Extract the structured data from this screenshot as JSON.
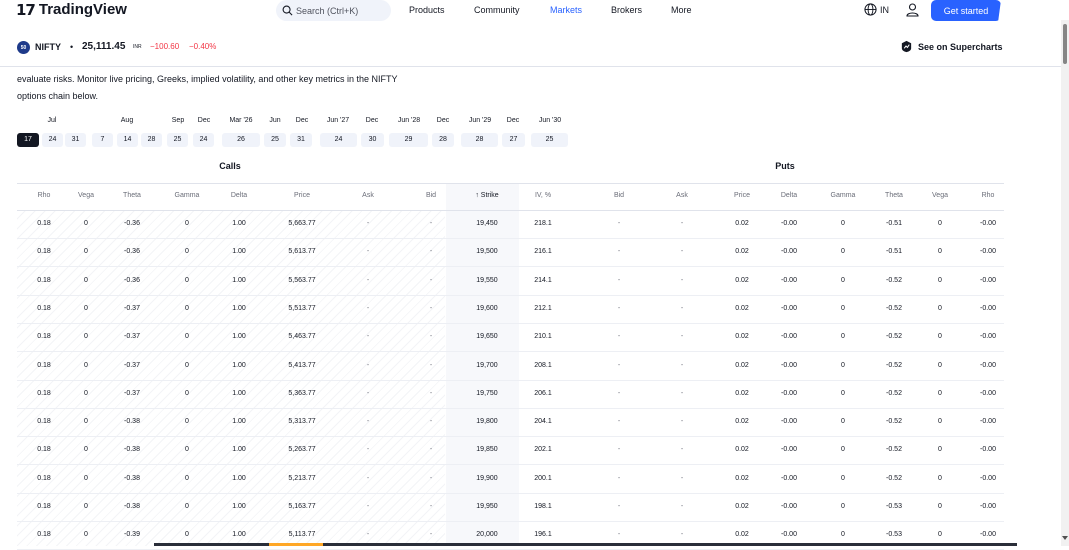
{
  "header": {
    "brand": "TradingView",
    "logo_mark": "17",
    "search_placeholder": "Search (Ctrl+K)",
    "nav": [
      "Products",
      "Community",
      "Markets",
      "Brokers",
      "More"
    ],
    "active_nav": "Markets",
    "region": "IN",
    "cta": "Get started",
    "accent_color": "#2962ff"
  },
  "symbol": {
    "badge": "50",
    "name": "NIFTY",
    "separator": "•",
    "price": "25,111.45",
    "currency": "INR",
    "change": "−100.60",
    "change_pct": "−0.40%",
    "change_color": "#f23645",
    "supercharts_label": "See on Supercharts"
  },
  "description": {
    "line1": "evaluate risks. Monitor live pricing, Greeks, implied volatility, and other key metrics in the NIFTY",
    "line2": "options chain below."
  },
  "expirations": {
    "months": [
      "Jul",
      "Aug",
      "Sep",
      "Dec",
      "Mar '26",
      "Jun",
      "Dec",
      "Jun '27",
      "Dec",
      "Jun '28",
      "Dec",
      "Jun '29",
      "Dec",
      "Jun '30"
    ],
    "days": [
      "17",
      "24",
      "31",
      "7",
      "14",
      "28",
      "25",
      "24",
      "26",
      "25",
      "31",
      "24",
      "30",
      "29",
      "28",
      "28",
      "27",
      "25"
    ],
    "selected": "17"
  },
  "table": {
    "calls_label": "Calls",
    "puts_label": "Puts",
    "columns": [
      "Rho",
      "Vega",
      "Theta",
      "Gamma",
      "Delta",
      "Price",
      "Ask",
      "Bid",
      "↑ Strike",
      "IV, %",
      "Bid",
      "Ask",
      "Price",
      "Delta",
      "Gamma",
      "Theta",
      "Vega",
      "Rho"
    ],
    "rows": [
      [
        "0.18",
        "0",
        "-0.36",
        "0",
        "1.00",
        "5,663.77",
        "-",
        "-",
        "19,450",
        "218.1",
        "-",
        "-",
        "0.02",
        "-0.00",
        "0",
        "-0.51",
        "0",
        "-0.00"
      ],
      [
        "0.18",
        "0",
        "-0.36",
        "0",
        "1.00",
        "5,613.77",
        "-",
        "-",
        "19,500",
        "216.1",
        "-",
        "-",
        "0.02",
        "-0.00",
        "0",
        "-0.51",
        "0",
        "-0.00"
      ],
      [
        "0.18",
        "0",
        "-0.36",
        "0",
        "1.00",
        "5,563.77",
        "-",
        "-",
        "19,550",
        "214.1",
        "-",
        "-",
        "0.02",
        "-0.00",
        "0",
        "-0.52",
        "0",
        "-0.00"
      ],
      [
        "0.18",
        "0",
        "-0.37",
        "0",
        "1.00",
        "5,513.77",
        "-",
        "-",
        "19,600",
        "212.1",
        "-",
        "-",
        "0.02",
        "-0.00",
        "0",
        "-0.52",
        "0",
        "-0.00"
      ],
      [
        "0.18",
        "0",
        "-0.37",
        "0",
        "1.00",
        "5,463.77",
        "-",
        "-",
        "19,650",
        "210.1",
        "-",
        "-",
        "0.02",
        "-0.00",
        "0",
        "-0.52",
        "0",
        "-0.00"
      ],
      [
        "0.18",
        "0",
        "-0.37",
        "0",
        "1.00",
        "5,413.77",
        "-",
        "-",
        "19,700",
        "208.1",
        "-",
        "-",
        "0.02",
        "-0.00",
        "0",
        "-0.52",
        "0",
        "-0.00"
      ],
      [
        "0.18",
        "0",
        "-0.37",
        "0",
        "1.00",
        "5,363.77",
        "-",
        "-",
        "19,750",
        "206.1",
        "-",
        "-",
        "0.02",
        "-0.00",
        "0",
        "-0.52",
        "0",
        "-0.00"
      ],
      [
        "0.18",
        "0",
        "-0.38",
        "0",
        "1.00",
        "5,313.77",
        "-",
        "-",
        "19,800",
        "204.1",
        "-",
        "-",
        "0.02",
        "-0.00",
        "0",
        "-0.52",
        "0",
        "-0.00"
      ],
      [
        "0.18",
        "0",
        "-0.38",
        "0",
        "1.00",
        "5,263.77",
        "-",
        "-",
        "19,850",
        "202.1",
        "-",
        "-",
        "0.02",
        "-0.00",
        "0",
        "-0.52",
        "0",
        "-0.00"
      ],
      [
        "0.18",
        "0",
        "-0.38",
        "0",
        "1.00",
        "5,213.77",
        "-",
        "-",
        "19,900",
        "200.1",
        "-",
        "-",
        "0.02",
        "-0.00",
        "0",
        "-0.52",
        "0",
        "-0.00"
      ],
      [
        "0.18",
        "0",
        "-0.38",
        "0",
        "1.00",
        "5,163.77",
        "-",
        "-",
        "19,950",
        "198.1",
        "-",
        "-",
        "0.02",
        "-0.00",
        "0",
        "-0.53",
        "0",
        "-0.00"
      ],
      [
        "0.18",
        "0",
        "-0.39",
        "0",
        "1.00",
        "5,113.77",
        "-",
        "-",
        "20,000",
        "196.1",
        "-",
        "-",
        "0.02",
        "-0.00",
        "0",
        "-0.53",
        "0",
        "-0.00"
      ]
    ]
  }
}
